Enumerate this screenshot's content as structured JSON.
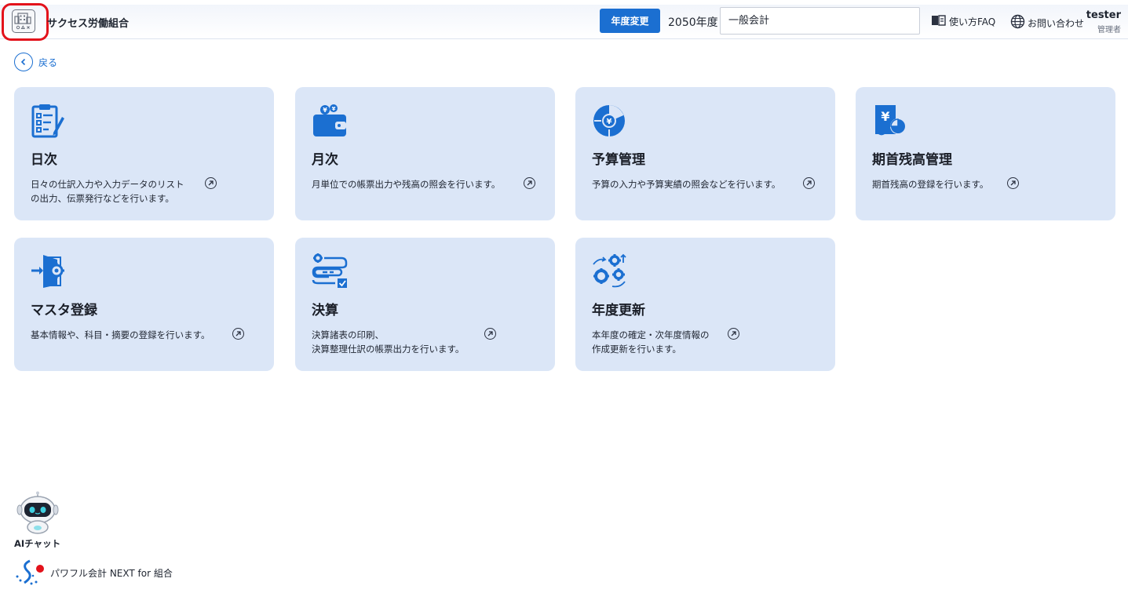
{
  "header": {
    "org_name": "サクセス労働組合",
    "year_change_label": "年度変更",
    "fiscal_year": "2050年度",
    "account_value": "一般会計",
    "faq_label": "使い方FAQ",
    "contact_label": "お問い合わせ",
    "user_name": "tester",
    "user_role": "管理者"
  },
  "nav": {
    "back_label": "戻る"
  },
  "cards": [
    {
      "title": "日次",
      "desc_line1": "日々の仕訳入力や入力データのリスト",
      "desc_line2": "の出力、伝票発行などを行います。",
      "icon": "clipboard-checklist-icon"
    },
    {
      "title": "月次",
      "desc_line1": "月単位での帳票出力や残高の照会を行います。",
      "desc_line2": "",
      "icon": "wallet-yen-icon"
    },
    {
      "title": "予算管理",
      "desc_line1": "予算の入力や予算実績の照会などを行います。",
      "desc_line2": "",
      "icon": "budget-gear-yen-icon"
    },
    {
      "title": "期首残高管理",
      "desc_line1": "期首残高の登録を行います。",
      "desc_line2": "",
      "icon": "yen-document-pie-icon"
    },
    {
      "title": "マスタ登録",
      "desc_line1": "基本情報や、科目・摘要の登録を行います。",
      "desc_line2": "",
      "icon": "door-gear-icon"
    },
    {
      "title": "決算",
      "desc_line1": "決算諸表の印刷、",
      "desc_line2": "決算整理仕訳の帳票出力を行います。",
      "icon": "settings-checklist-icon"
    },
    {
      "title": "年度更新",
      "desc_line1": "本年度の確定・次年度情報の",
      "desc_line2": "作成更新を行います。",
      "icon": "gears-refresh-icon"
    }
  ],
  "footer": {
    "ai_chat_label": "AIチャット",
    "product_name": "パワフル会計 NEXT for 組合"
  },
  "colors": {
    "accent": "#1b6fd1",
    "card_bg": "#dbe6f7",
    "highlight": "#e3121b"
  }
}
